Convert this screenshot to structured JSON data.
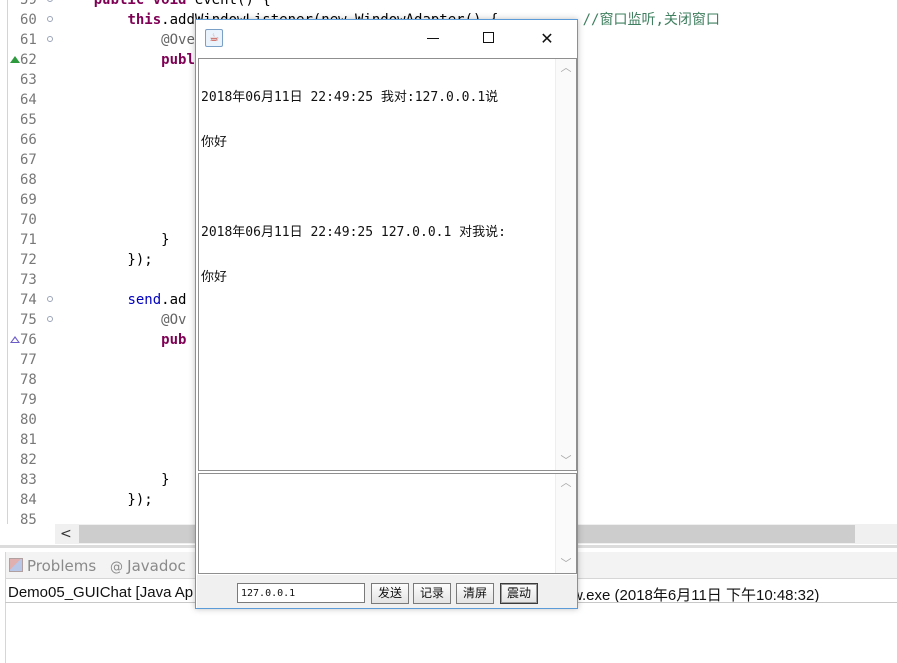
{
  "editor": {
    "lines": [
      {
        "num": "59",
        "fold": true,
        "code": [
          {
            "t": "    "
          },
          {
            "t": "public",
            "c": "kw"
          },
          {
            "t": " "
          },
          {
            "t": "void",
            "c": "kw"
          },
          {
            "t": " event() {"
          }
        ]
      },
      {
        "num": "60",
        "fold": true,
        "code": [
          {
            "t": "        "
          },
          {
            "t": "this",
            "c": "kw"
          },
          {
            "t": ".addWindowListener(new WindowAdapter() {"
          },
          {
            "t": "          "
          },
          {
            "t": "//窗口监听,关闭窗口",
            "c": "cmt"
          }
        ]
      },
      {
        "num": "61",
        "fold": true,
        "code": [
          {
            "t": "            "
          },
          {
            "t": "@Override",
            "c": "ann"
          }
        ]
      },
      {
        "num": "62",
        "fold": false,
        "marker": "up",
        "code": [
          {
            "t": "            "
          },
          {
            "t": "public",
            "c": "kw"
          }
        ]
      },
      {
        "num": "63",
        "fold": false,
        "code": []
      },
      {
        "num": "64",
        "fold": false,
        "code": []
      },
      {
        "num": "65",
        "fold": false,
        "code": []
      },
      {
        "num": "66",
        "fold": false,
        "code": []
      },
      {
        "num": "67",
        "fold": false,
        "code": []
      },
      {
        "num": "68",
        "fold": false,
        "code": []
      },
      {
        "num": "69",
        "fold": false,
        "code": []
      },
      {
        "num": "70",
        "fold": false,
        "code": []
      },
      {
        "num": "71",
        "fold": false,
        "code": [
          {
            "t": "            }"
          }
        ]
      },
      {
        "num": "72",
        "fold": false,
        "code": [
          {
            "t": "        });"
          }
        ]
      },
      {
        "num": "73",
        "fold": false,
        "code": []
      },
      {
        "num": "74",
        "fold": true,
        "code": [
          {
            "t": "        "
          },
          {
            "t": "send",
            "c": "fld"
          },
          {
            "t": ".ad"
          }
        ]
      },
      {
        "num": "75",
        "fold": true,
        "code": [
          {
            "t": "            "
          },
          {
            "t": "@Ov",
            "c": "ann"
          }
        ]
      },
      {
        "num": "76",
        "fold": false,
        "marker": "up-hollow",
        "code": [
          {
            "t": "            "
          },
          {
            "t": "pub",
            "c": "kw"
          }
        ]
      },
      {
        "num": "77",
        "fold": false,
        "code": []
      },
      {
        "num": "78",
        "fold": false,
        "code": []
      },
      {
        "num": "79",
        "fold": false,
        "code": []
      },
      {
        "num": "80",
        "fold": false,
        "code": []
      },
      {
        "num": "81",
        "fold": false,
        "code": []
      },
      {
        "num": "82",
        "fold": false,
        "code": []
      },
      {
        "num": "83",
        "fold": false,
        "code": [
          {
            "t": "            }"
          }
        ]
      },
      {
        "num": "84",
        "fold": false,
        "code": [
          {
            "t": "        });"
          }
        ]
      },
      {
        "num": "85",
        "fold": false,
        "code": []
      }
    ],
    "hscroll_left_arrow": "<"
  },
  "panel": {
    "tabs": [
      {
        "label": "Problems",
        "icon": "problems-icon"
      },
      {
        "label": "Javadoc",
        "icon": "at-icon"
      }
    ],
    "console_left": "Demo05_GUIChat [Java Ap",
    "console_right": "w.exe (2018年6月11日 下午10:48:32)"
  },
  "chat_window": {
    "icon": "java-coffee-icon",
    "minimize_icon": "minimize-icon",
    "maximize_icon": "maximize-icon",
    "close_glyph": "✕",
    "messages": [
      {
        "header": "2018年06月11日 22:49:25 我对:127.0.0.1说",
        "body": "你好"
      },
      {
        "header": "2018年06月11日 22:49:25 127.0.0.1 对我说:",
        "body": "你好"
      }
    ],
    "ip_value": "127.0.0.1",
    "buttons": {
      "send": "发送",
      "record": "记录",
      "clear": "清屏",
      "shake": "震动"
    }
  }
}
